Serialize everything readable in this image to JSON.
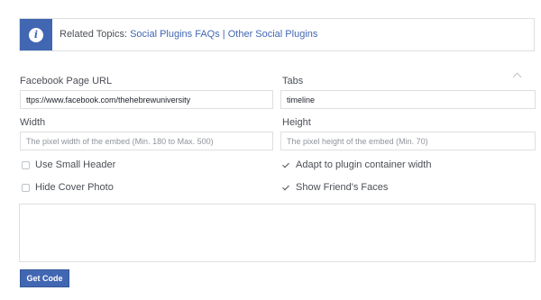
{
  "related": {
    "prefix": "Related Topics:",
    "link1": "Social Plugins FAQs",
    "separator": "|",
    "link2": "Other Social Plugins",
    "icon": "info-icon",
    "icon_glyph": "i"
  },
  "fields": {
    "page_url": {
      "label": "Facebook Page URL",
      "value": "ttps://www.facebook.com/thehebrewuniversity"
    },
    "tabs": {
      "label": "Tabs",
      "value": "timeline"
    },
    "width": {
      "label": "Width",
      "placeholder": "The pixel width of the embed (Min. 180 to Max. 500)"
    },
    "height": {
      "label": "Height",
      "placeholder": "The pixel height of the embed (Min. 70)"
    }
  },
  "options": {
    "small_header": {
      "label": "Use Small Header",
      "checked": false
    },
    "adapt_width": {
      "label": "Adapt to plugin container width",
      "checked": true
    },
    "hide_cover": {
      "label": "Hide Cover Photo",
      "checked": false
    },
    "show_faces": {
      "label": "Show Friend's Faces",
      "checked": true
    }
  },
  "code": {
    "value": ""
  },
  "button": {
    "label": "Get Code"
  },
  "colors": {
    "accent": "#4267b2",
    "border": "#dddfe2",
    "text": "#4b4f56"
  }
}
